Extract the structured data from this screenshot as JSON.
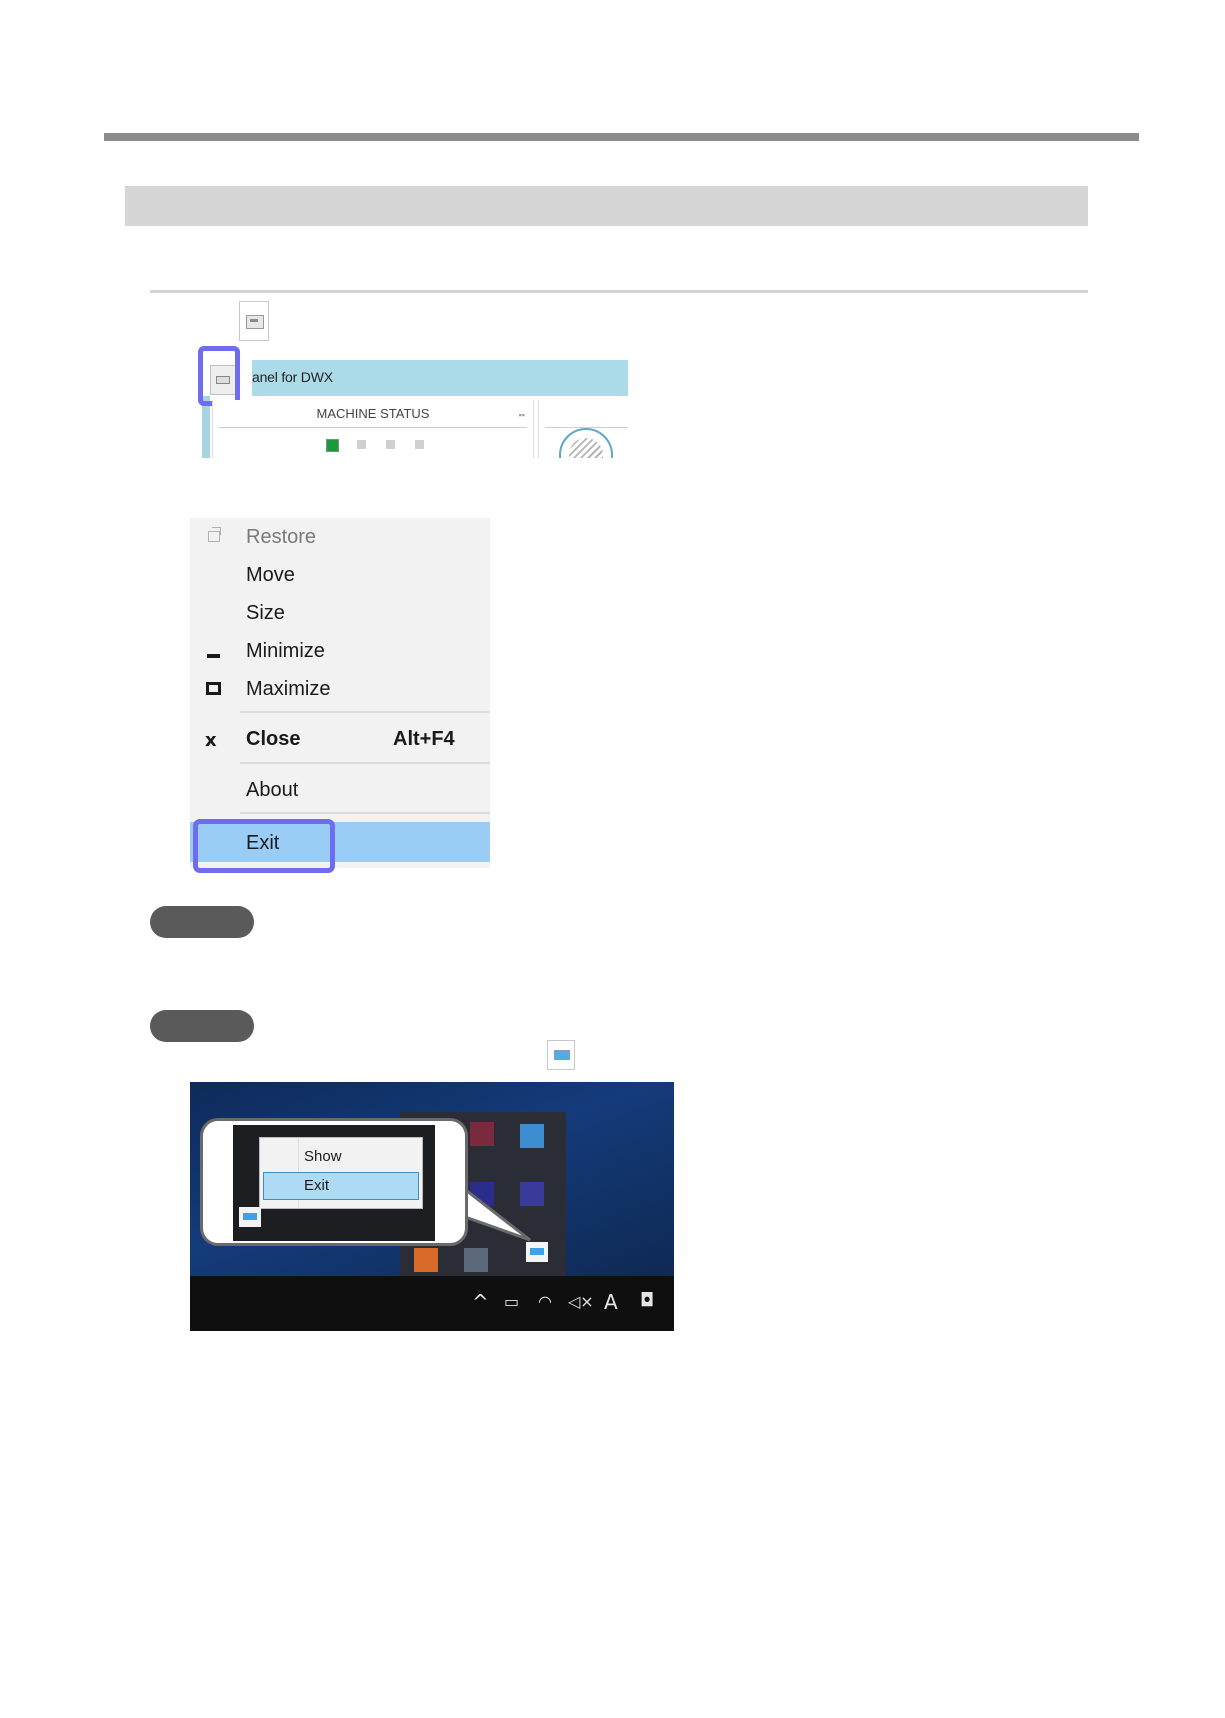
{
  "window_screenshot": {
    "title_fragment": "anel for DWX",
    "panel_title": "MACHINE STATUS"
  },
  "system_menu": {
    "items": [
      {
        "label": "Restore",
        "icon": "restore-icon",
        "disabled": true
      },
      {
        "label": "Move"
      },
      {
        "label": "Size"
      },
      {
        "label": "Minimize",
        "icon": "minimize-icon"
      },
      {
        "label": "Maximize",
        "icon": "maximize-icon"
      },
      {
        "label": "Close",
        "icon": "close-icon",
        "shortcut": "Alt+F4"
      },
      {
        "label": "About"
      },
      {
        "label": "Exit",
        "selected": true
      }
    ],
    "close_glyph": "x",
    "highlight_color": "#99cdf5",
    "callout_color": "#6f6cf0"
  },
  "tray_screenshot": {
    "context_menu": [
      "Show",
      "Exit"
    ],
    "taskbar_glyphs": {
      "chevron": "^",
      "ime": "A"
    }
  }
}
